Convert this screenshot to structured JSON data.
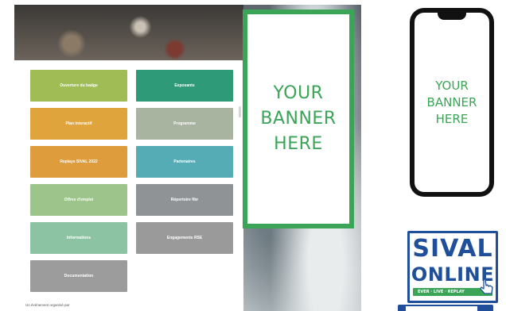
{
  "app": {
    "tiles": [
      {
        "label": "Ouverture du badge",
        "color": "#9fbc55"
      },
      {
        "label": "Exposants",
        "color": "#2f9a78"
      },
      {
        "label": "Plan interactif",
        "color": "#e0a43c"
      },
      {
        "label": "Programme",
        "color": "#a8b3a0"
      },
      {
        "label": "Replays SIVAL 2022",
        "color": "#df9c3c"
      },
      {
        "label": "Partenaires",
        "color": "#56acb5"
      },
      {
        "label": "Offres d'emploi",
        "color": "#9cc48b"
      },
      {
        "label": "Répertoire fibr",
        "color": "#8f9396"
      },
      {
        "label": "Informations",
        "color": "#8cc4a3"
      },
      {
        "label": "Engagements RSE",
        "color": "#9a9a9a"
      },
      {
        "label": "Documentation",
        "color": "#9c9c9c"
      }
    ],
    "footer": "Un événement organisé par"
  },
  "banner_tall": {
    "line1": "YOUR",
    "line2": "BANNER",
    "line3": "HERE"
  },
  "banner_phone": {
    "line1": "YOUR",
    "line2": "BANNER",
    "line3": "HERE"
  },
  "logo": {
    "line1": "SIVAL",
    "line2": "ONLINE",
    "tagline": "EVER · LIVE · REPLAY",
    "brand_color": "#1f4f9a",
    "accent_color": "#3aa457"
  }
}
